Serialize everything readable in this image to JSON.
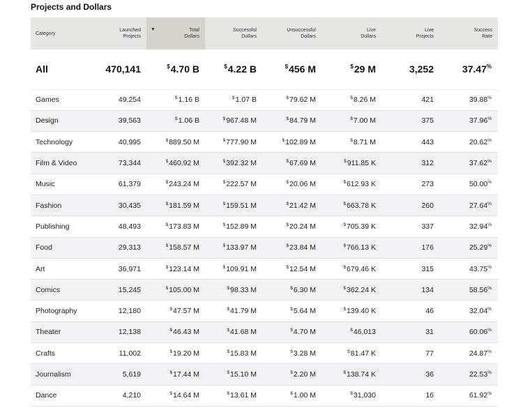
{
  "chart_data": {
    "type": "table",
    "title": "Projects and Dollars",
    "sorted_column": "total_dollars",
    "columns": [
      {
        "key": "category",
        "label": "Category"
      },
      {
        "key": "launched_projects",
        "label": "Launched\nProjects"
      },
      {
        "key": "total_dollars",
        "label": "Total\nDollars"
      },
      {
        "key": "successful_dollars",
        "label": "Successful\nDollars"
      },
      {
        "key": "unsuccessful_dollars",
        "label": "Unsuccessful\nDollars"
      },
      {
        "key": "live_dollars",
        "label": "Live\nDollars"
      },
      {
        "key": "live_projects",
        "label": "Live\nProjects"
      },
      {
        "key": "success_rate",
        "label": "Success\nRate"
      }
    ],
    "total_row": {
      "category": "All",
      "launched_projects": "470,141",
      "total_dollars": "4.70 B",
      "successful_dollars": "4.22 B",
      "unsuccessful_dollars": "456 M",
      "live_dollars": "29 M",
      "live_projects": "3,252",
      "success_rate": "37.47"
    },
    "rows": [
      {
        "category": "Games",
        "launched_projects": "49,254",
        "total_dollars": "1.16 B",
        "successful_dollars": "1.07 B",
        "unsuccessful_dollars": "79.62 M",
        "live_dollars": "8.26 M",
        "live_projects": "421",
        "success_rate": "39.88"
      },
      {
        "category": "Design",
        "launched_projects": "39,563",
        "total_dollars": "1.06 B",
        "successful_dollars": "967.48 M",
        "unsuccessful_dollars": "84.79 M",
        "live_dollars": "7.00 M",
        "live_projects": "375",
        "success_rate": "37.96"
      },
      {
        "category": "Technology",
        "launched_projects": "40,995",
        "total_dollars": "889.50 M",
        "successful_dollars": "777.90 M",
        "unsuccessful_dollars": "102.89 M",
        "live_dollars": "8.71 M",
        "live_projects": "443",
        "success_rate": "20.62"
      },
      {
        "category": "Film & Video",
        "launched_projects": "73,344",
        "total_dollars": "460.92 M",
        "successful_dollars": "392.32 M",
        "unsuccessful_dollars": "67.69 M",
        "live_dollars": "911.85 K",
        "live_projects": "312",
        "success_rate": "37.62"
      },
      {
        "category": "Music",
        "launched_projects": "61,379",
        "total_dollars": "243.24 M",
        "successful_dollars": "222.57 M",
        "unsuccessful_dollars": "20.06 M",
        "live_dollars": "612.93 K",
        "live_projects": "273",
        "success_rate": "50.00"
      },
      {
        "category": "Fashion",
        "launched_projects": "30,435",
        "total_dollars": "181.59 M",
        "successful_dollars": "159.51 M",
        "unsuccessful_dollars": "21.42 M",
        "live_dollars": "663.78 K",
        "live_projects": "260",
        "success_rate": "27.64"
      },
      {
        "category": "Publishing",
        "launched_projects": "48,493",
        "total_dollars": "173.83 M",
        "successful_dollars": "152.89 M",
        "unsuccessful_dollars": "20.24 M",
        "live_dollars": "705.39 K",
        "live_projects": "337",
        "success_rate": "32.94"
      },
      {
        "category": "Food",
        "launched_projects": "29,313",
        "total_dollars": "158.57 M",
        "successful_dollars": "133.97 M",
        "unsuccessful_dollars": "23.84 M",
        "live_dollars": "766.13 K",
        "live_projects": "176",
        "success_rate": "25.29"
      },
      {
        "category": "Art",
        "launched_projects": "36,971",
        "total_dollars": "123.14 M",
        "successful_dollars": "109.91 M",
        "unsuccessful_dollars": "12.54 M",
        "live_dollars": "679.46 K",
        "live_projects": "315",
        "success_rate": "43.75"
      },
      {
        "category": "Comics",
        "launched_projects": "15,245",
        "total_dollars": "105.00 M",
        "successful_dollars": "98.33 M",
        "unsuccessful_dollars": "6.30 M",
        "live_dollars": "362.24 K",
        "live_projects": "134",
        "success_rate": "58.56"
      },
      {
        "category": "Photography",
        "launched_projects": "12,180",
        "total_dollars": "47.57 M",
        "successful_dollars": "41.79 M",
        "unsuccessful_dollars": "5.64 M",
        "live_dollars": "139.40 K",
        "live_projects": "46",
        "success_rate": "32.04"
      },
      {
        "category": "Theater",
        "launched_projects": "12,138",
        "total_dollars": "46.43 M",
        "successful_dollars": "41.68 M",
        "unsuccessful_dollars": "4.70 M",
        "live_dollars": "46,013",
        "live_projects": "31",
        "success_rate": "60.06"
      },
      {
        "category": "Crafts",
        "launched_projects": "11,002",
        "total_dollars": "19.20 M",
        "successful_dollars": "15.83 M",
        "unsuccessful_dollars": "3.28 M",
        "live_dollars": "81.47 K",
        "live_projects": "77",
        "success_rate": "24.87"
      },
      {
        "category": "Journalism",
        "launched_projects": "5,619",
        "total_dollars": "17.44 M",
        "successful_dollars": "15.10 M",
        "unsuccessful_dollars": "2.20 M",
        "live_dollars": "138.74 K",
        "live_projects": "36",
        "success_rate": "22.53"
      },
      {
        "category": "Dance",
        "launched_projects": "4,210",
        "total_dollars": "14.64 M",
        "successful_dollars": "13.61 M",
        "unsuccessful_dollars": "1.00 M",
        "live_dollars": "31,030",
        "live_projects": "16",
        "success_rate": "61.92"
      }
    ],
    "symbols": {
      "currency": "$",
      "percent": "%",
      "sort_indicator": "▼"
    }
  }
}
